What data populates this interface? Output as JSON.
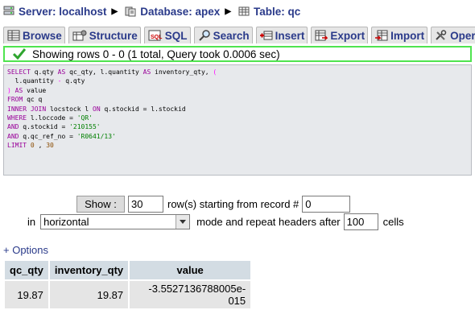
{
  "breadcrumb": [
    {
      "icon": "server-icon",
      "label": "Server: localhost"
    },
    {
      "icon": "database-icon",
      "label": "Database: apex"
    },
    {
      "icon": "table-icon",
      "label": "Table: qc"
    }
  ],
  "tabs": [
    {
      "icon": "browse-icon",
      "label": "Browse"
    },
    {
      "icon": "structure-icon",
      "label": "Structure"
    },
    {
      "icon": "sql-icon",
      "label": "SQL"
    },
    {
      "icon": "search-icon",
      "label": "Search"
    },
    {
      "icon": "insert-icon",
      "label": "Insert"
    },
    {
      "icon": "export-icon",
      "label": "Export"
    },
    {
      "icon": "import-icon",
      "label": "Import"
    },
    {
      "icon": "operations-icon",
      "label": "Oper"
    }
  ],
  "result_message": "Showing rows 0 - 0 (1 total, Query took 0.0006 sec)",
  "sql": [
    "SELECT q.qty AS qc_qty, l.quantity AS inventory_qty, (",
    "  l.quantity - q.qty",
    ") AS value",
    "FROM qc q",
    "INNER JOIN locstock l ON q.stockid = l.stockid",
    "WHERE l.loccode = 'QR'",
    "AND q.stockid = '210155'",
    "AND q.qc_ref_no = 'R0641/13'",
    "LIMIT 0 , 30"
  ],
  "navigation": {
    "show_button": "Show :",
    "rows_value": "30",
    "rows_label": "row(s) starting from record #",
    "start_value": "0",
    "in_label": "in",
    "mode_value": "horizontal",
    "mode_label": "mode and repeat headers after",
    "repeat_value": "100",
    "cells_label": "cells"
  },
  "options_link": "+ Options",
  "table": {
    "columns": [
      "qc_qty",
      "inventory_qty",
      "value"
    ],
    "rows": [
      [
        "19.87",
        "19.87",
        "-3.5527136788005e-015"
      ]
    ]
  },
  "colors": {
    "link": "#2a3a8a",
    "success_border": "#4fe44f",
    "sql_bg": "#e7e9ec",
    "header_bg": "#d3dce3",
    "cell_bg": "#e5e5e5"
  }
}
